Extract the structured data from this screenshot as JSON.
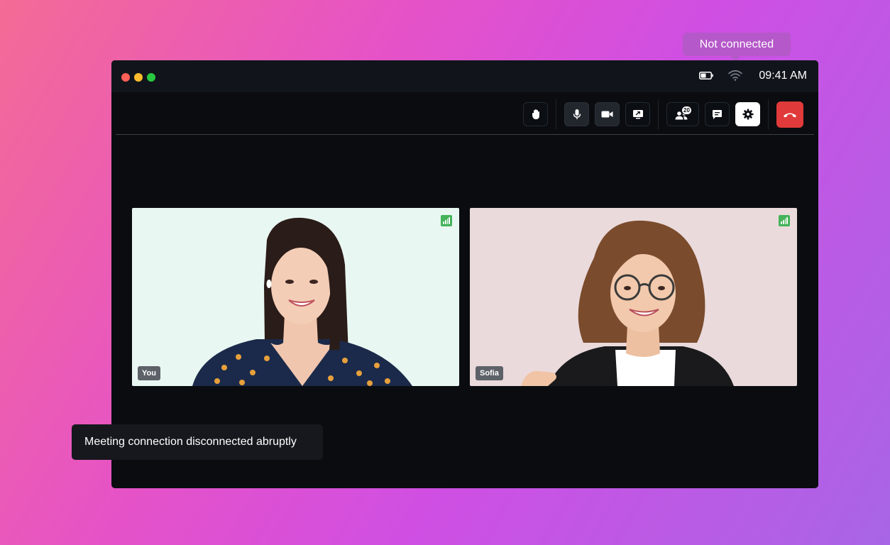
{
  "network_tooltip": {
    "text": "Not connected"
  },
  "titlebar": {
    "time": "09:41 AM",
    "icons": [
      "battery-icon",
      "wifi-icon"
    ]
  },
  "toolbar": {
    "buttons": [
      {
        "name": "raise-hand-button",
        "icon": "hand-icon"
      },
      {
        "name": "microphone-button",
        "icon": "microphone-icon"
      },
      {
        "name": "camera-button",
        "icon": "video-camera-icon"
      },
      {
        "name": "share-screen-button",
        "icon": "share-screen-icon"
      },
      {
        "name": "participants-button",
        "icon": "people-icon"
      },
      {
        "name": "chat-button",
        "icon": "chat-icon"
      },
      {
        "name": "settings-button",
        "icon": "gear-icon"
      },
      {
        "name": "end-call-button",
        "icon": "phone-hangup-icon"
      }
    ],
    "participants_count": "20"
  },
  "tiles": [
    {
      "name": "You",
      "signal": "good"
    },
    {
      "name": "Sofia",
      "signal": "good"
    }
  ],
  "toast": {
    "message": "Meeting connection disconnected abruptly"
  },
  "colors": {
    "end_call": "#e03a3a",
    "signal": "#44b35a",
    "tooltip": "#b558c9"
  }
}
